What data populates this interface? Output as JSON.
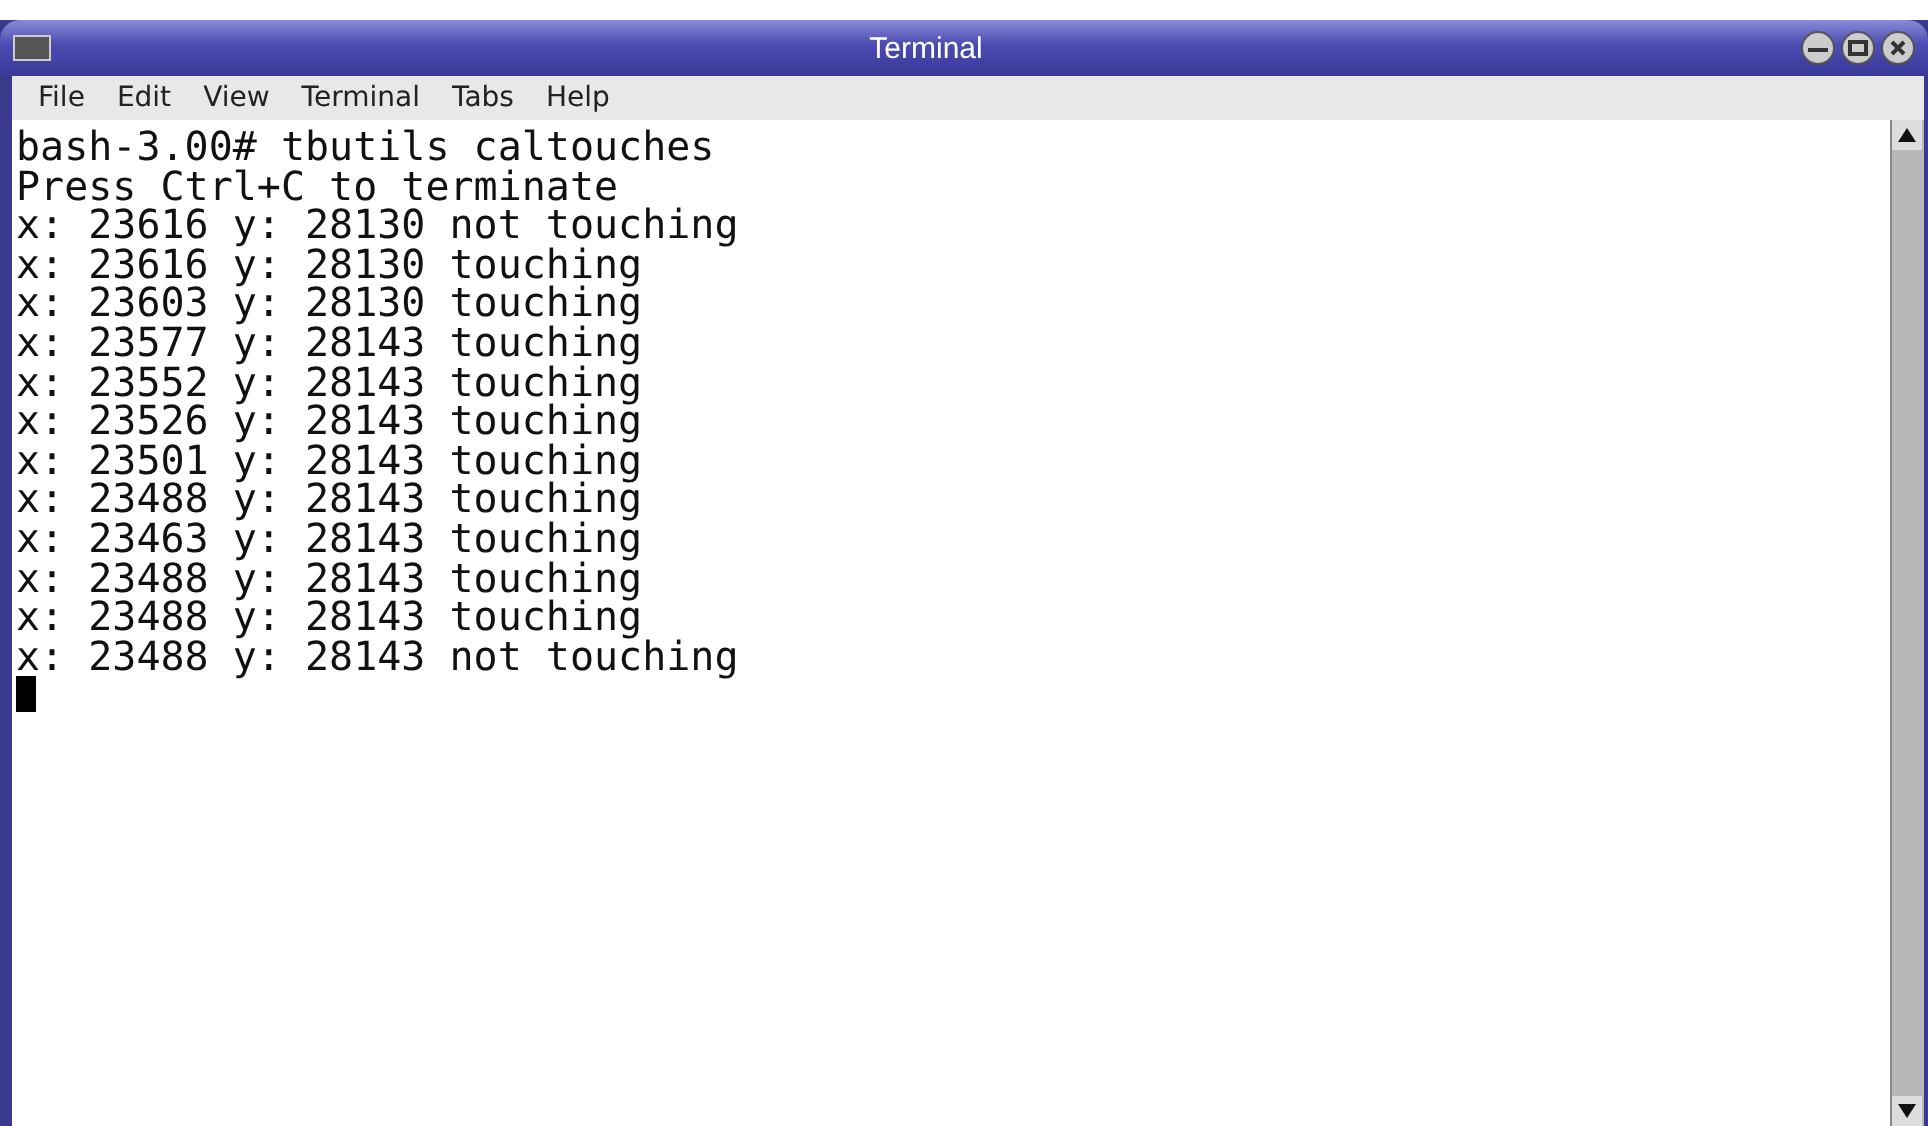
{
  "window": {
    "title": "Terminal"
  },
  "menu": [
    "File",
    "Edit",
    "View",
    "Terminal",
    "Tabs",
    "Help"
  ],
  "terminal": {
    "lines": [
      "bash-3.00# tbutils caltouches",
      "Press Ctrl+C to terminate",
      "x: 23616 y: 28130 not touching",
      "x: 23616 y: 28130 touching",
      "x: 23603 y: 28130 touching",
      "x: 23577 y: 28143 touching",
      "x: 23552 y: 28143 touching",
      "x: 23526 y: 28143 touching",
      "x: 23501 y: 28143 touching",
      "x: 23488 y: 28143 touching",
      "x: 23463 y: 28143 touching",
      "x: 23488 y: 28143 touching",
      "x: 23488 y: 28143 touching",
      "x: 23488 y: 28143 not touching"
    ]
  }
}
